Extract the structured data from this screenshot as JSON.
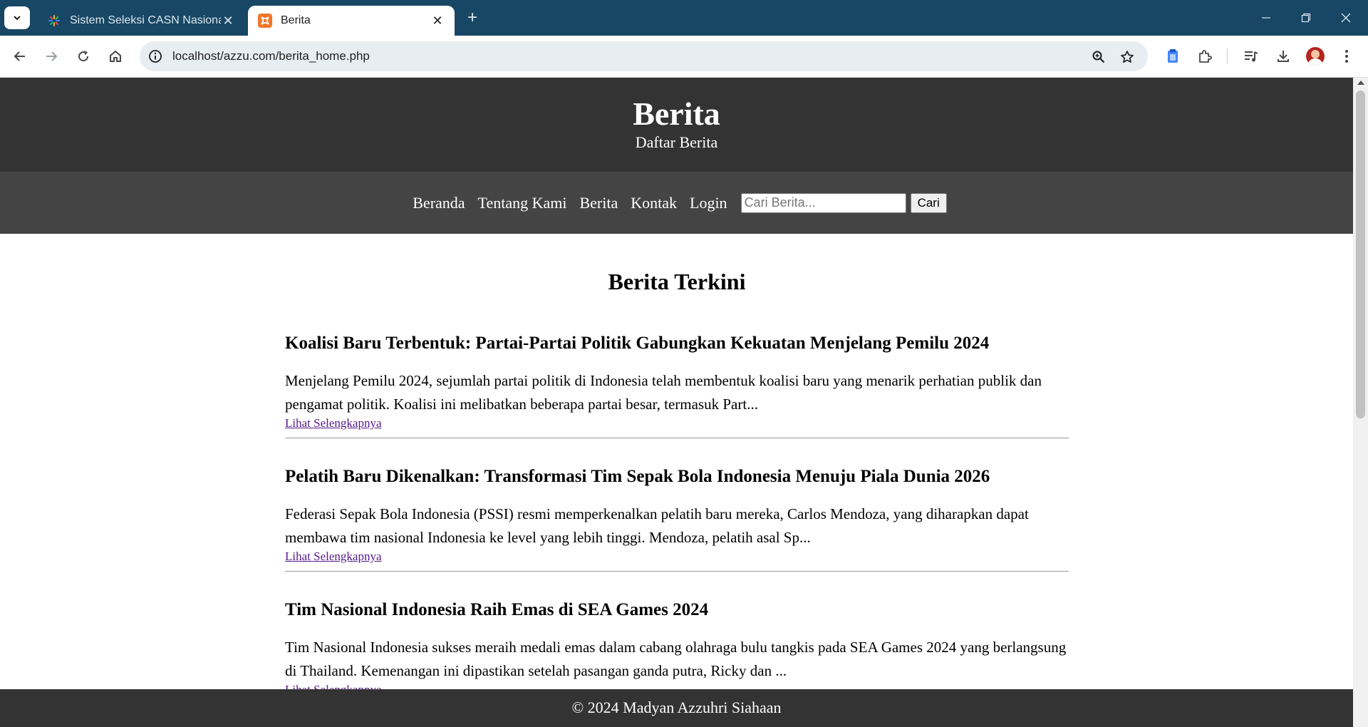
{
  "browser": {
    "tabs": [
      {
        "title": "Sistem Seleksi CASN Nasional",
        "active": false
      },
      {
        "title": "Berita",
        "active": true
      }
    ],
    "new_tab": "+",
    "close_glyph": "✕",
    "url": "localhost/azzu.com/berita_home.php",
    "colors": {
      "tabbar": "#174764",
      "omnibox": "#e8edf2"
    },
    "icons": [
      "tab-search-icon",
      "back-icon",
      "forward-icon",
      "reload-icon",
      "home-icon",
      "site-info-icon",
      "zoom-icon",
      "bookmark-star-icon",
      "clipboard-icon",
      "extensions-icon",
      "media-icon",
      "download-icon",
      "avatar",
      "menu-icon",
      "minimize-icon",
      "restore-icon",
      "close-window-icon"
    ]
  },
  "site": {
    "header": {
      "title": "Berita",
      "subtitle": "Daftar Berita"
    },
    "nav": {
      "links": [
        "Beranda",
        "Tentang Kami",
        "Berita",
        "Kontak",
        "Login"
      ],
      "search_placeholder": "Cari Berita...",
      "search_button": "Cari"
    },
    "section_title": "Berita Terkini",
    "articles": [
      {
        "title": "Koalisi Baru Terbentuk: Partai-Partai Politik Gabungkan Kekuatan Menjelang Pemilu 2024",
        "excerpt": "Menjelang Pemilu 2024, sejumlah partai politik di Indonesia telah membentuk koalisi baru yang menarik perhatian publik dan pengamat politik. Koalisi ini melibatkan beberapa partai besar, termasuk Part...",
        "link": "Lihat Selengkapnya"
      },
      {
        "title": "Pelatih Baru Dikenalkan: Transformasi Tim Sepak Bola Indonesia Menuju Piala Dunia 2026",
        "excerpt": "Federasi Sepak Bola Indonesia (PSSI) resmi memperkenalkan pelatih baru mereka, Carlos Mendoza, yang diharapkan dapat membawa tim nasional Indonesia ke level yang lebih tinggi. Mendoza, pelatih asal Sp...",
        "link": "Lihat Selengkapnya"
      },
      {
        "title": "Tim Nasional Indonesia Raih Emas di SEA Games 2024",
        "excerpt": "Tim Nasional Indonesia sukses meraih medali emas dalam cabang olahraga bulu tangkis pada SEA Games 2024 yang berlangsung di Thailand. Kemenangan ini dipastikan setelah pasangan ganda putra, Ricky dan ...",
        "link": "Lihat Selengkapnya"
      }
    ],
    "footer": "© 2024 Madyan Azzuhri Siahaan",
    "colors": {
      "header": "#333333",
      "nav": "#444444",
      "visited_link": "#551a8b"
    }
  }
}
